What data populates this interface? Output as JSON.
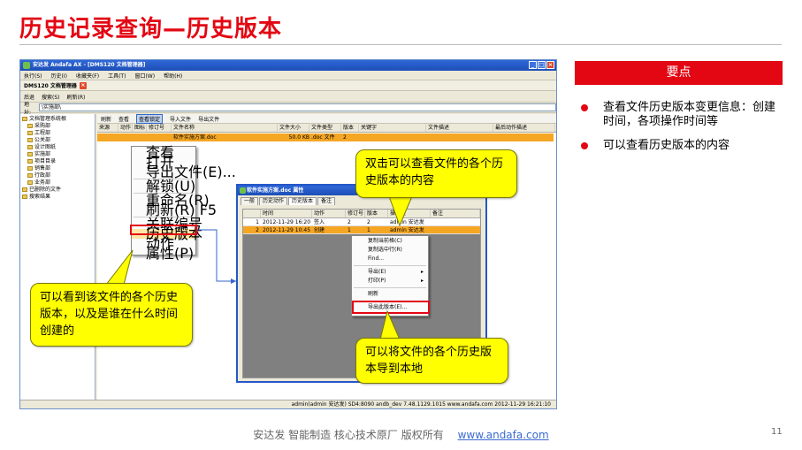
{
  "slide": {
    "title": "历史记录查询—历史版本",
    "key_header": "要点",
    "bullets": [
      "查看文件历史版本变更信息：创建时间，各项操作时间等",
      "可以查看历史版本的内容"
    ],
    "footer_text": "安达发   智能制造 核心技术原厂    版权所有",
    "footer_link": "www.andafa.com",
    "page_number": "11"
  },
  "window": {
    "title": "安达发 Andafa AX - [DMS120 文档管理器]",
    "menu": [
      "执行(S)",
      "历史(I)",
      "收藏夹(F)",
      "工具(T)",
      "窗口(W)",
      "帮助(H)"
    ],
    "doc_tab": "DMS120 文档管理器",
    "nav": [
      "后退",
      "搜索(S)",
      "刷新(R)"
    ],
    "address_label": "地址:",
    "address_value": "\\实施部\\",
    "tree": [
      "文档管理系统根",
      "采购部",
      "工程部",
      "公关部",
      "设计图纸",
      "实施部",
      "项目目录",
      "销售部",
      "行政部",
      "业务部",
      "已删除的文件",
      "搜索结果"
    ],
    "toolbar2": [
      "刷新",
      "查看",
      "查看锁定",
      "导入文件",
      "导出文件"
    ],
    "columns": [
      "来源",
      "动作",
      "图标",
      "修订号",
      "文件名称",
      "文件大小",
      "文件类型",
      "版本",
      "关键字",
      "文件描述",
      "最后动作描述"
    ],
    "selected_row": {
      "revision": "2",
      "name": "软件实施方案.doc",
      "size": "50.0 KB",
      "type": ".doc 文件",
      "version": "2"
    },
    "ctx_menu": [
      "查看",
      "打开",
      "导出文件(E)...",
      "解锁(U)",
      "重命名(R)",
      "刷新(R)  F5",
      "关联编号",
      "历史版本",
      "动作",
      "属性(P)"
    ],
    "status": "admin(admin 安达发)  SD4:8090  andb_dev  7.48.1129.1015  www.andafa.com  2012-11-29 16:21:10"
  },
  "dialog": {
    "title": "软件实施方案.doc 属性",
    "tabs": [
      "一般",
      "历史动作",
      "历史版本",
      "备注"
    ],
    "columns": [
      "时间",
      "动作",
      "修订号",
      "版本",
      "操作员",
      "备注"
    ],
    "rows": [
      {
        "index": "1",
        "time": "2012-11-29 16:20",
        "action": "签入",
        "revision": "2",
        "version": "2",
        "operator": "admin 安达发"
      },
      {
        "index": "2",
        "time": "2012-11-29 10:45",
        "action": "创建",
        "revision": "1",
        "version": "1",
        "operator": "admin 安达发"
      }
    ],
    "ctx_menu": [
      "复制当前格(C)",
      "复制选中行(R)",
      "Find...",
      "导出(E)",
      "打印(P)",
      "刷新",
      "导出此版本(E)..."
    ]
  },
  "callouts": {
    "c1": "双击可以查看文件的各个历史版本的内容",
    "c2": "可以看到该文件的各个历史版本，以及是谁在什么时间创建的",
    "c3": "可以将文件的各个历史版本导到本地"
  },
  "colors": {
    "accent": "#e30613",
    "callout": "#ffff00",
    "selection": "#f5a623",
    "titlebar": "#2457c9"
  }
}
